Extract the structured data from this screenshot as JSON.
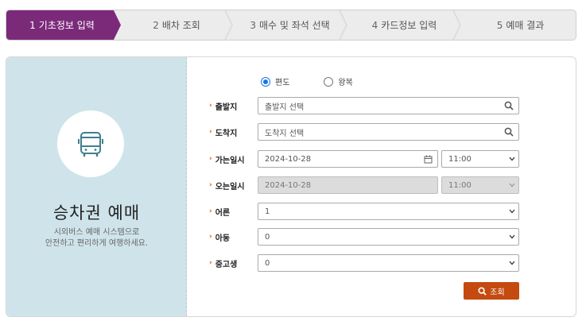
{
  "stepper": {
    "steps": [
      {
        "num": "1",
        "label": "기초정보 입력",
        "active": true
      },
      {
        "num": "2",
        "label": "배차 조회",
        "active": false
      },
      {
        "num": "3",
        "label": "매수 및 좌석 선택",
        "active": false
      },
      {
        "num": "4",
        "label": "카드정보 입력",
        "active": false
      },
      {
        "num": "5",
        "label": "예매 결과",
        "active": false
      }
    ],
    "active_color": "#7b2a7a"
  },
  "intro": {
    "icon": "bus-icon",
    "title": "승차권 예매",
    "desc_line1": "시외버스 예매 시스템으로",
    "desc_line2": "안전하고 편리하게 여행하세요."
  },
  "trip_type": {
    "one_way": "편도",
    "round_trip": "왕복",
    "selected": "one_way"
  },
  "form": {
    "departure": {
      "label": "출발지",
      "placeholder": "출발지 선택"
    },
    "arrival": {
      "label": "도착지",
      "placeholder": "도착지 선택"
    },
    "go_date": {
      "label": "가는일시",
      "date": "2024-10-28",
      "time": "11:00"
    },
    "return_date": {
      "label": "오는일시",
      "date": "2024-10-28",
      "time": "11:00",
      "disabled": true
    },
    "adult": {
      "label": "어른",
      "value": "1"
    },
    "child": {
      "label": "아동",
      "value": "0"
    },
    "student": {
      "label": "중고생",
      "value": "0"
    }
  },
  "actions": {
    "search_label": "조회"
  },
  "colors": {
    "accent": "#c54a0f",
    "panel_left": "#cfe4ea",
    "icon": "#3f7f8f"
  }
}
